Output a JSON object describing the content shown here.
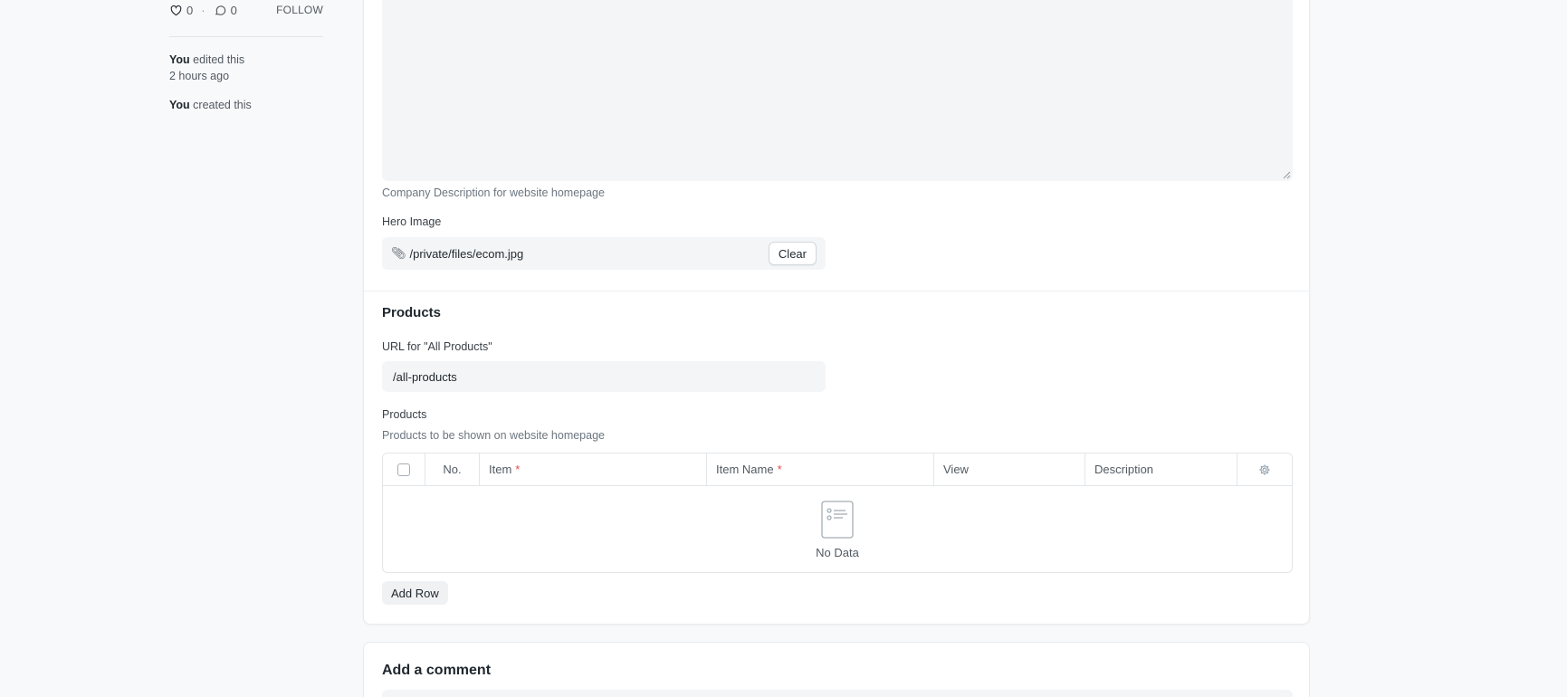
{
  "sidebar": {
    "likes": "0",
    "comments": "0",
    "separator": "·",
    "follow_label": "FOLLOW",
    "activity": [
      {
        "actor": "You",
        "action": "edited this",
        "time": "2 hours ago"
      },
      {
        "actor": "You",
        "action": "created this"
      }
    ]
  },
  "form": {
    "description_help": "Company Description for website homepage",
    "hero_image": {
      "label": "Hero Image",
      "value": "/private/files/ecom.jpg",
      "clear_label": "Clear"
    },
    "products_section": {
      "title": "Products",
      "url_label": "URL for \"All Products\"",
      "url_value": "/all-products",
      "table_label": "Products",
      "table_help": "Products to be shown on website homepage",
      "columns": {
        "no": "No.",
        "item": "Item",
        "item_name": "Item Name",
        "view": "View",
        "description": "Description",
        "required_marker": "*"
      },
      "empty_text": "No Data",
      "add_row_label": "Add Row"
    }
  },
  "comments": {
    "title": "Add a comment"
  }
}
